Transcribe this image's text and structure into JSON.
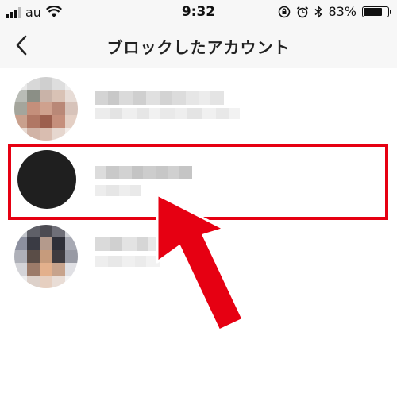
{
  "status_bar": {
    "carrier": "au",
    "time": "9:32",
    "battery": "83%",
    "battery_level": 0.83
  },
  "header": {
    "title": "ブロックしたアカウント",
    "back_icon": "chevron-left-icon"
  },
  "accounts": [
    {
      "username": "",
      "name": "",
      "avatar": "blurred-photo"
    },
    {
      "username": "",
      "name": "",
      "avatar": "black-circle"
    },
    {
      "username": "",
      "name": "",
      "avatar": "blurred-photo"
    }
  ],
  "annotation": {
    "highlight_color": "#e60012",
    "arrow_color": "#e60012"
  }
}
